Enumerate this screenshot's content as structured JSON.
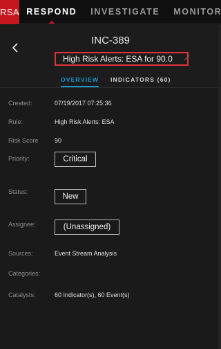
{
  "logo": "RSA",
  "nav": {
    "items": [
      {
        "label": "RESPOND",
        "active": true
      },
      {
        "label": "INVESTIGATE",
        "active": false
      },
      {
        "label": "MONITOR",
        "active": false
      }
    ]
  },
  "header": {
    "incident_id": "INC-389",
    "incident_name": "High Risk Alerts: ESA for 90.0",
    "tabs": [
      {
        "label": "OVERVIEW",
        "active": true
      },
      {
        "label": "INDICATORS (60)",
        "active": false
      }
    ]
  },
  "details": {
    "created_label": "Created:",
    "created_value": "07/19/2017 07:25:36",
    "rule_label": "Rule:",
    "rule_value": "High Risk Alerts: ESA",
    "risk_label": "Risk Score",
    "risk_value": "90",
    "priority_label": "Priority:",
    "priority_value": "Critical",
    "status_label": "Status:",
    "status_value": "New",
    "assignee_label": "Assignee:",
    "assignee_value": "(Unassigned)",
    "sources_label": "Sources:",
    "sources_value": "Event Stream Analysis",
    "categories_label": "Categories:",
    "categories_value": "",
    "catalysts_label": "Catalysts:",
    "catalysts_value": "60 Indicator(s), 60 Event(s)"
  },
  "colors": {
    "brand": "#c4161c",
    "accent": "#1a9bd7",
    "highlight": "#e0323a"
  }
}
